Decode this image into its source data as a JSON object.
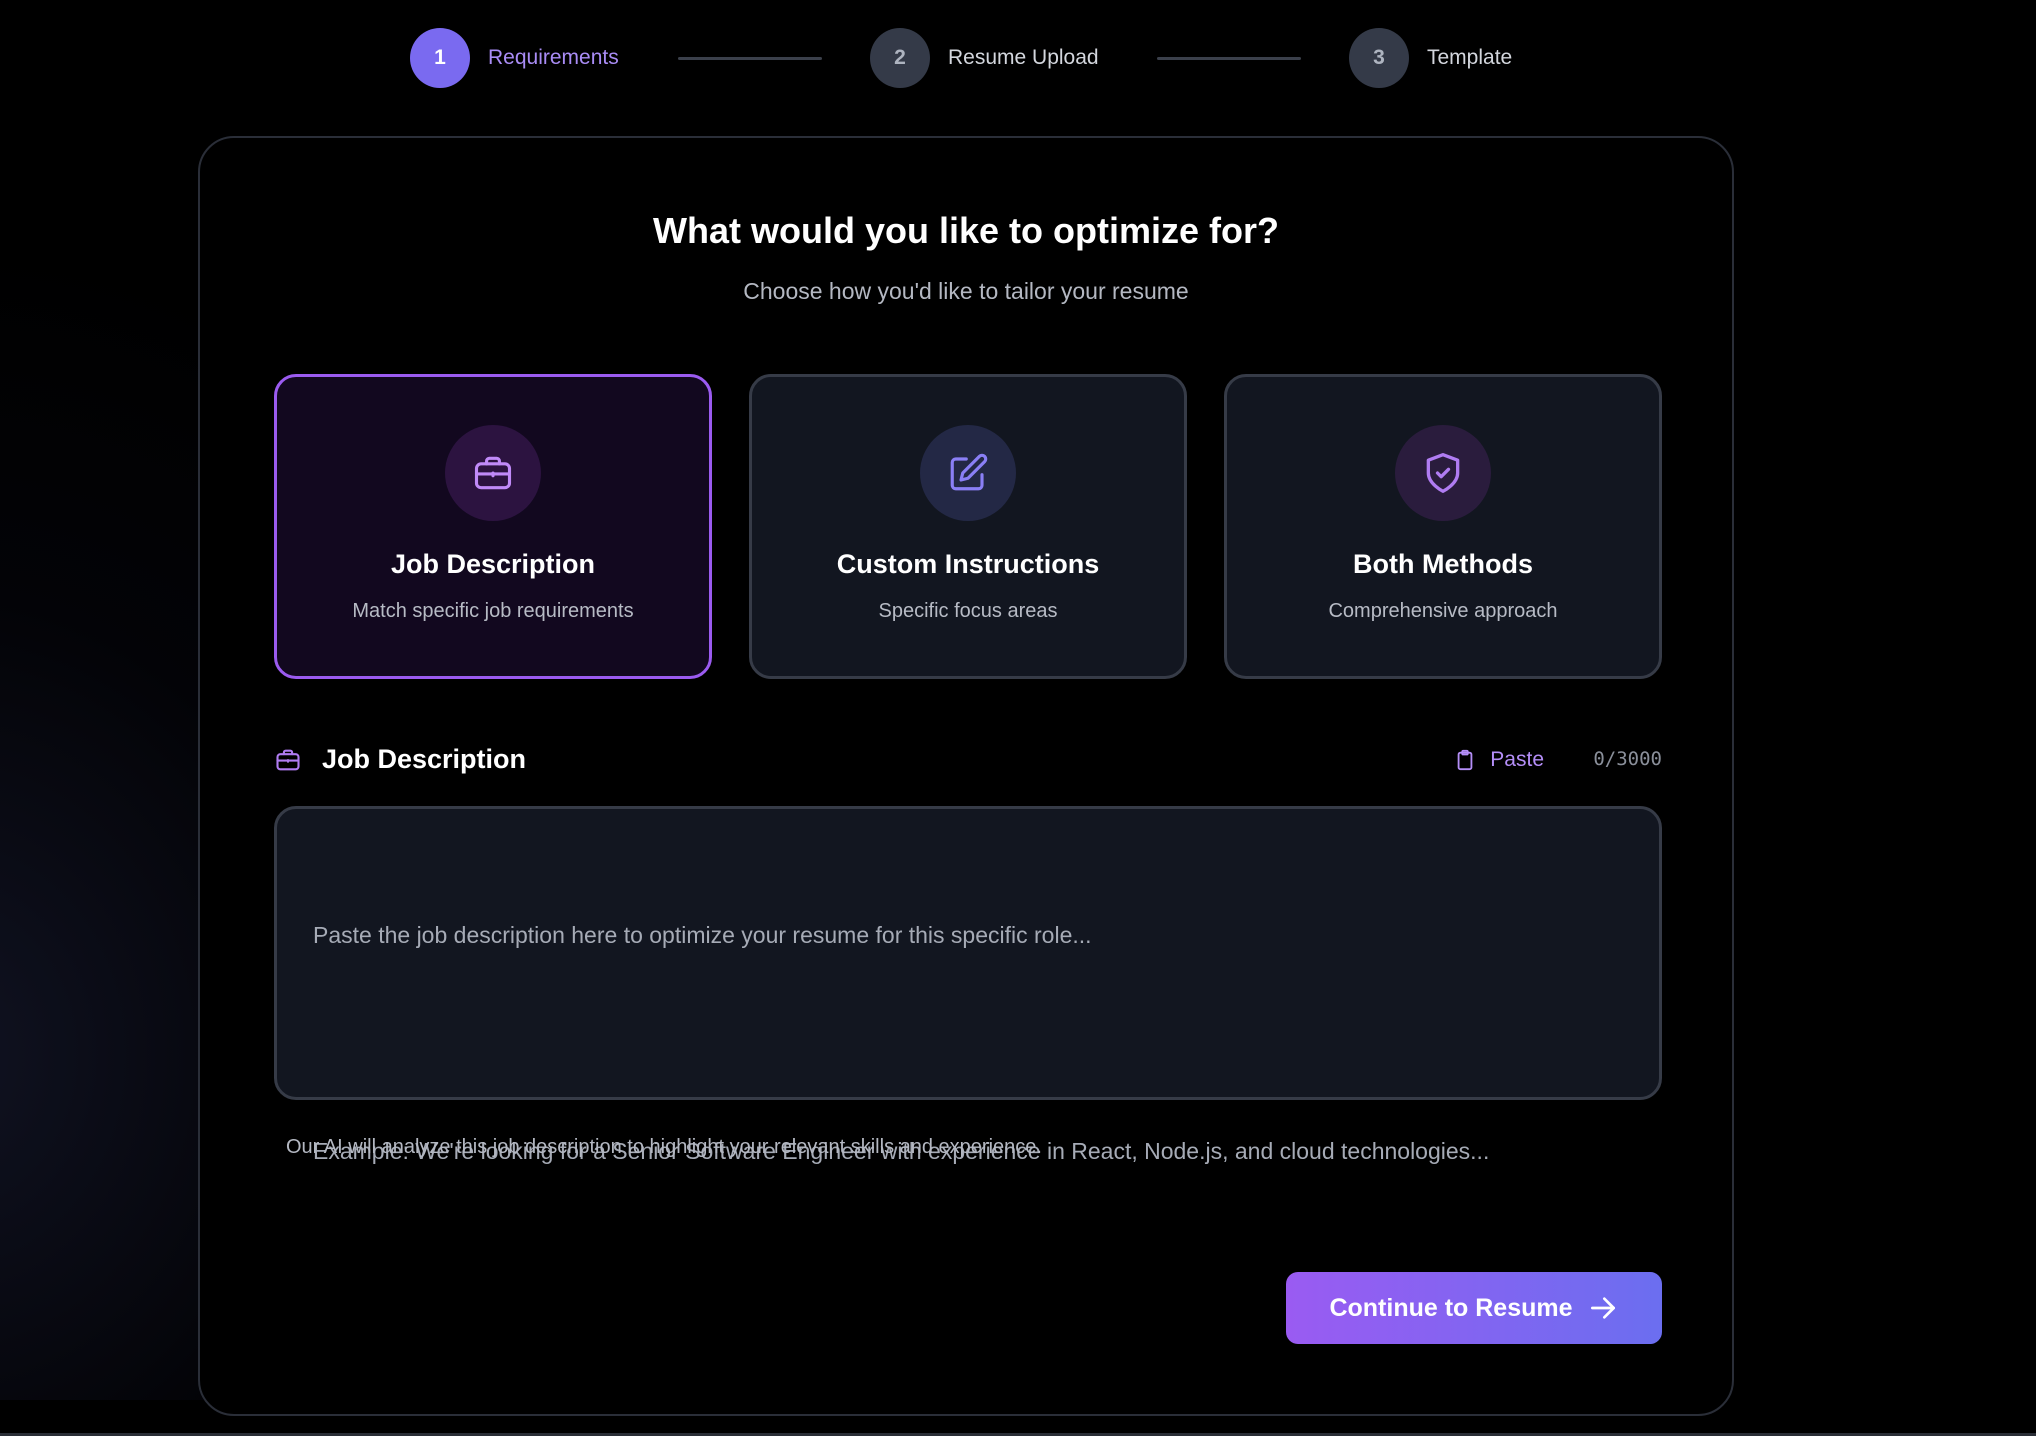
{
  "stepper": {
    "steps": [
      {
        "number": "1",
        "label": "Requirements",
        "state": "active"
      },
      {
        "number": "2",
        "label": "Resume Upload",
        "state": "upcoming"
      },
      {
        "number": "3",
        "label": "Template",
        "state": "upcoming"
      }
    ]
  },
  "card": {
    "title": "What would you like to optimize for?",
    "subtitle": "Choose how you'd like to tailor your resume"
  },
  "options": [
    {
      "title": "Job Description",
      "description": "Match specific job requirements",
      "icon": "briefcase-icon",
      "selected": true
    },
    {
      "title": "Custom Instructions",
      "description": "Specific focus areas",
      "icon": "edit-icon",
      "selected": false
    },
    {
      "title": "Both Methods",
      "description": "Comprehensive approach",
      "icon": "shield-check-icon",
      "selected": false
    }
  ],
  "job_description": {
    "title": "Job Description",
    "paste_label": "Paste",
    "counter": "0/3000",
    "placeholder_line1": "Paste the job description here to optimize your resume for this specific role...",
    "placeholder_line2": "Example: We're looking for a Senior Software Engineer with experience in React, Node.js, and cloud technologies...",
    "value": "",
    "helper": "Our AI will analyze this job description to highlight your relevant skills and experience."
  },
  "actions": {
    "continue_label": "Continue to Resume"
  },
  "colors": {
    "accent": "#9b5bf0",
    "accent_text": "#a98cf5",
    "button_gradient_start": "#9a5bf2",
    "button_gradient_end": "#6b6ef0",
    "surface": "#121620",
    "background": "#000000"
  }
}
